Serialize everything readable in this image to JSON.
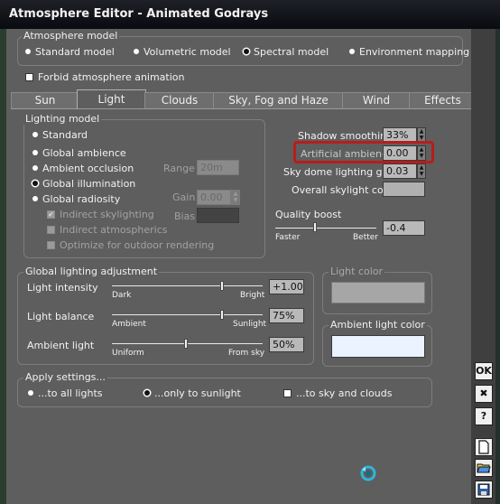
{
  "window": {
    "title": "Atmosphere Editor - Animated Godrays"
  },
  "atmosphere_model": {
    "group_label": "Atmosphere model",
    "options": [
      "Standard model",
      "Volumetric model",
      "Spectral model",
      "Environment mapping"
    ],
    "selected": "Spectral model"
  },
  "forbid_animation": {
    "label": "Forbid atmosphere animation",
    "checked": false
  },
  "tabs": [
    "Sun",
    "Light",
    "Clouds",
    "Sky, Fog and Haze",
    "Wind",
    "Effects"
  ],
  "active_tab": "Light",
  "lighting_model": {
    "group_label": "Lighting model",
    "options": [
      "Standard",
      "Global ambience",
      "Ambient occlusion",
      "Global illumination",
      "Global radiosity"
    ],
    "selected": "Global illumination",
    "range": {
      "label": "Range",
      "value": "20m"
    },
    "gain": {
      "label": "Gain",
      "value": "0.00"
    },
    "bias": {
      "label": "Bias",
      "value": ""
    },
    "sub_options": [
      {
        "label": "Indirect skylighting",
        "checked": true
      },
      {
        "label": "Indirect atmospherics",
        "checked": false
      },
      {
        "label": "Optimize for outdoor rendering",
        "checked": false
      }
    ]
  },
  "right_settings": {
    "shadow_smoothing": {
      "label": "Shadow smoothing",
      "value": "33%"
    },
    "artificial_ambience": {
      "label": "Artificial ambience",
      "value": "0.00"
    },
    "sky_dome_gain": {
      "label": "Sky dome lighting gain",
      "value": "0.03"
    },
    "overall_skylight_color": {
      "label": "Overall skylight color",
      "color": "#b0b0b0"
    },
    "quality_boost": {
      "label": "Quality boost",
      "min_label": "Faster",
      "max_label": "Better",
      "value": "-0.4",
      "level": 0.39
    }
  },
  "global_lighting": {
    "group_label": "Global lighting adjustment",
    "sliders": [
      {
        "label": "Light intensity",
        "min_label": "Dark",
        "max_label": "Bright",
        "value": "+1.00",
        "level": 0.73
      },
      {
        "label": "Light balance",
        "min_label": "Ambient",
        "max_label": "Sunlight",
        "value": "75%",
        "level": 0.73
      },
      {
        "label": "Ambient light",
        "min_label": "Uniform",
        "max_label": "From sky",
        "value": "50%",
        "level": 0.49
      }
    ]
  },
  "light_color": {
    "label": "Light color",
    "color": "#a6a6a6"
  },
  "ambient_light_color": {
    "label": "Ambient light color",
    "color": "#eaf3ff"
  },
  "apply_settings": {
    "group_label": "Apply settings...",
    "options": [
      "...to all lights",
      "...only to sunlight",
      "...to sky and clouds"
    ],
    "selected": "...only to sunlight"
  },
  "sidebar": {
    "ok_label": "OK",
    "close_label": "✖",
    "help_label": "?"
  },
  "colors": {
    "highlight": "#b81c1c",
    "panel": "#5e5e5e",
    "titlebar": "#0f1016"
  }
}
